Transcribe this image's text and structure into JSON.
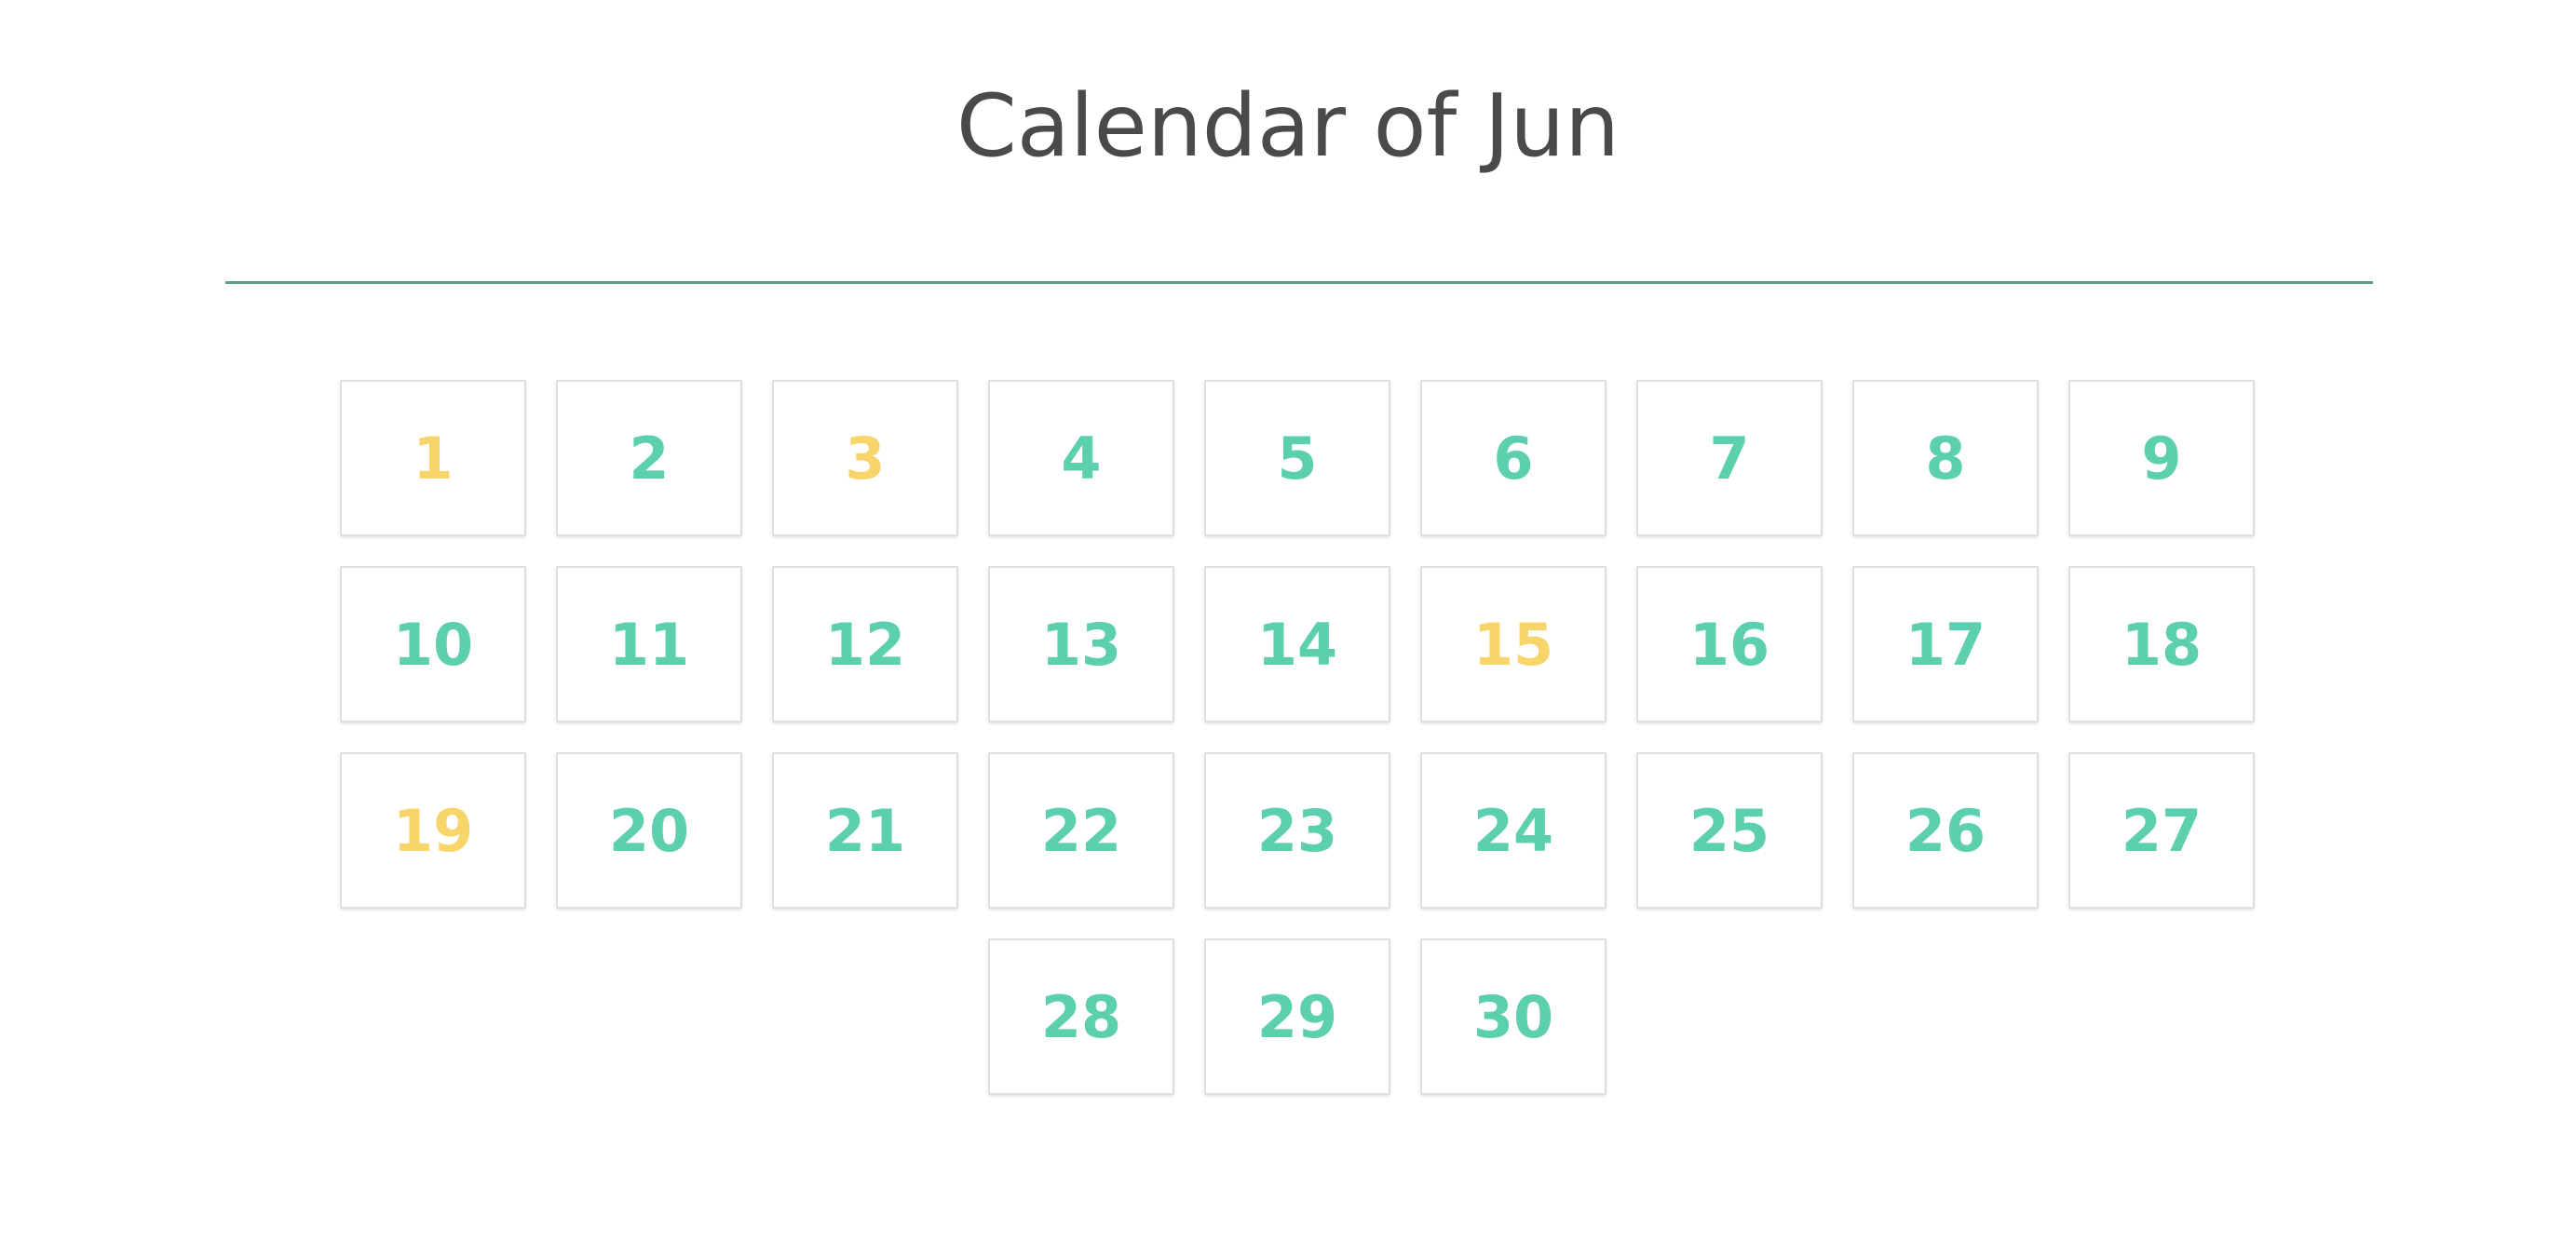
{
  "title": "Calendar of Jun",
  "colors": {
    "normal": "#5ccfae",
    "highlight": "#f7d56b",
    "divider": "#5c9c8c",
    "title": "#4a4a4a"
  },
  "days": [
    {
      "label": "1",
      "highlight": true
    },
    {
      "label": "2",
      "highlight": false
    },
    {
      "label": "3",
      "highlight": true
    },
    {
      "label": "4",
      "highlight": false
    },
    {
      "label": "5",
      "highlight": false
    },
    {
      "label": "6",
      "highlight": false
    },
    {
      "label": "7",
      "highlight": false
    },
    {
      "label": "8",
      "highlight": false
    },
    {
      "label": "9",
      "highlight": false
    },
    {
      "label": "10",
      "highlight": false
    },
    {
      "label": "11",
      "highlight": false
    },
    {
      "label": "12",
      "highlight": false
    },
    {
      "label": "13",
      "highlight": false
    },
    {
      "label": "14",
      "highlight": false
    },
    {
      "label": "15",
      "highlight": true
    },
    {
      "label": "16",
      "highlight": false
    },
    {
      "label": "17",
      "highlight": false
    },
    {
      "label": "18",
      "highlight": false
    },
    {
      "label": "19",
      "highlight": true
    },
    {
      "label": "20",
      "highlight": false
    },
    {
      "label": "21",
      "highlight": false
    },
    {
      "label": "22",
      "highlight": false
    },
    {
      "label": "23",
      "highlight": false
    },
    {
      "label": "24",
      "highlight": false
    },
    {
      "label": "25",
      "highlight": false
    },
    {
      "label": "26",
      "highlight": false
    },
    {
      "label": "27",
      "highlight": false
    },
    {
      "label": "28",
      "highlight": false
    },
    {
      "label": "29",
      "highlight": false
    },
    {
      "label": "30",
      "highlight": false
    }
  ]
}
